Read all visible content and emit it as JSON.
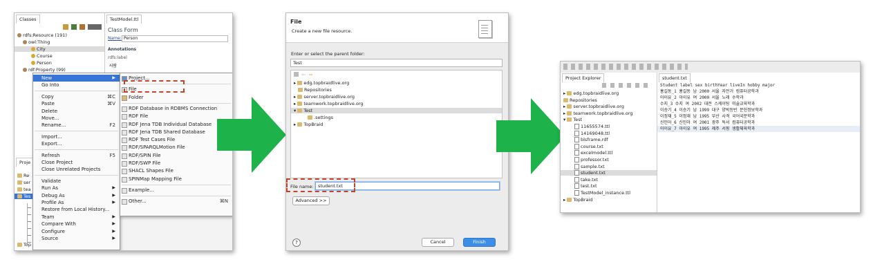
{
  "colors": {
    "arrow": "#1db34a",
    "selection": "#3875d7",
    "dash": "#c0442a"
  },
  "left": {
    "classes_tab": "Classes",
    "tree": [
      {
        "label": "rdfs:Resource (191)"
      },
      {
        "label": "owl:Thing"
      },
      {
        "label": "City"
      },
      {
        "label": "Course"
      },
      {
        "label": "Person"
      },
      {
        "label": "rdf:Property (99)"
      }
    ],
    "editor_tab": "TestModel.ttl",
    "class_form_title": "Class Form",
    "name_label": "Name:",
    "name_value": "Person",
    "annotations_label": "Annotations",
    "rdfs_label": "rdfs:label",
    "label_value": "사람",
    "project_tab": "Proje",
    "project_tree": [
      "Re",
      "ser",
      "tea",
      "Tes",
      "Top"
    ],
    "context_menu": [
      {
        "label": "New",
        "shortcut": "",
        "sub": true
      },
      {
        "label": "Go Into",
        "shortcut": "",
        "sub": false
      },
      {
        "label": "Copy",
        "shortcut": "⌘C",
        "sub": false
      },
      {
        "label": "Paste",
        "shortcut": "⌘V",
        "sub": false
      },
      {
        "label": "Delete",
        "shortcut": "",
        "sub": false
      },
      {
        "label": "Move...",
        "shortcut": "",
        "sub": false
      },
      {
        "label": "Rename...",
        "shortcut": "F2",
        "sub": false
      },
      {
        "label": "Import...",
        "shortcut": "",
        "sub": false
      },
      {
        "label": "Export...",
        "shortcut": "",
        "sub": false
      },
      {
        "label": "Refresh",
        "shortcut": "F5",
        "sub": false
      },
      {
        "label": "Close Project",
        "shortcut": "",
        "sub": false
      },
      {
        "label": "Close Unrelated Projects",
        "shortcut": "",
        "sub": false
      },
      {
        "label": "Validate",
        "shortcut": "",
        "sub": false
      },
      {
        "label": "Run As",
        "shortcut": "",
        "sub": true
      },
      {
        "label": "Debug As",
        "shortcut": "",
        "sub": true
      },
      {
        "label": "Profile As",
        "shortcut": "",
        "sub": true
      },
      {
        "label": "Restore from Local History...",
        "shortcut": "",
        "sub": false
      },
      {
        "label": "Team",
        "shortcut": "",
        "sub": true
      },
      {
        "label": "Compare With",
        "shortcut": "",
        "sub": true
      },
      {
        "label": "Configure",
        "shortcut": "",
        "sub": true
      },
      {
        "label": "Source",
        "shortcut": "",
        "sub": true
      }
    ],
    "new_submenu": [
      {
        "label": "Project..."
      },
      {
        "label": "File"
      },
      {
        "label": "Folder"
      },
      {
        "label": "RDF Database in RDBMS Connection"
      },
      {
        "label": "RDF File"
      },
      {
        "label": "RDF Jena TDB Individual Database"
      },
      {
        "label": "RDF Jena TDB Shared Database"
      },
      {
        "label": "RDF Test Cases File"
      },
      {
        "label": "RDF/SPARQLMotion File"
      },
      {
        "label": "RDF/SPIN File"
      },
      {
        "label": "RDF/SWP File"
      },
      {
        "label": "SHACL Shapes File"
      },
      {
        "label": "SPINMap Mapping File"
      },
      {
        "label": "Example..."
      },
      {
        "label": "Other...",
        "shortcut": "⌘N"
      }
    ]
  },
  "middle": {
    "title": "File",
    "subtitle": "Create a new file resource.",
    "parent_folder_label": "Enter or select the parent folder:",
    "parent_folder_value": "Test",
    "tree": [
      {
        "label": "edg.topbraidlive.org"
      },
      {
        "label": "Repositories"
      },
      {
        "label": "server.topbraidlive.org"
      },
      {
        "label": "teamwork.topbraidlive.org"
      },
      {
        "label": "Test"
      },
      {
        "label": ".settings"
      },
      {
        "label": "TopBraid"
      }
    ],
    "file_name_label": "File name:",
    "file_name_value": "student.txt",
    "advanced_button": "Advanced >>",
    "cancel_button": "Cancel",
    "finish_button": "Finish",
    "help_icon": "?"
  },
  "right": {
    "explorer_tab": "Project Explorer",
    "editor_tab": "student.txt",
    "tree": [
      {
        "label": "edg.topbraidlive.org"
      },
      {
        "label": "Repositories"
      },
      {
        "label": "server.topbraidlive.org"
      },
      {
        "label": "teamwork.topbraidlive.org"
      },
      {
        "label": "Test"
      },
      {
        "label": "11655574.ttl"
      },
      {
        "label": "14169048.ttl"
      },
      {
        "label": "blsframe.rdf"
      },
      {
        "label": "course.txt"
      },
      {
        "label": "excelmodel.ttl"
      },
      {
        "label": "professor.txt"
      },
      {
        "label": "sample.txt"
      },
      {
        "label": "student.txt"
      },
      {
        "label": "take.txt"
      },
      {
        "label": "test.txt"
      },
      {
        "label": "TestModel_instance.ttl"
      },
      {
        "label": "TopBraid"
      }
    ],
    "editor_lines": [
      "Student label  sex birthYear  liveIn  hobby  major",
      "홍길동_1  홍길동   남  2000   서울 자전거  컴퓨터공학과",
      "아이유_2  아이유   여  2000   서울 노래 수학과",
      "수지_3  수지 여   2002   대전 스케이팅 미술교육학과",
      "이승기_4  이승기   남  1999   대구 양박등반  문헌정보학과",
      "이정재_5  이정재   남  1995   부산 사격 국어국문학과",
      "신민아_6  신민아   여  2001   광주 독서 컴퓨터공학과",
      "아이유_7  아이유   여  1995   제주 서핑 생활체육학과"
    ]
  }
}
